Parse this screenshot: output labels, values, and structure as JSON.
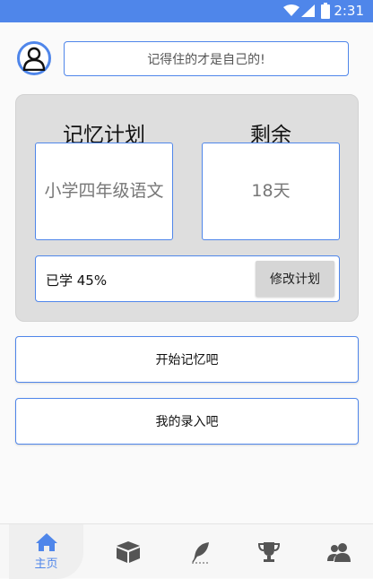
{
  "status_bar": {
    "time": "2:31",
    "icons": [
      "wifi-icon",
      "signal-icon",
      "battery-icon"
    ]
  },
  "header": {
    "motto": "记得住的才是自己的!"
  },
  "plan": {
    "plan_title": "记忆计划",
    "remaining_title": "剩余",
    "plan_name": "小学四年级语文",
    "remaining_days": "18天",
    "progress_text": "已学 45%",
    "progress_percent": 45,
    "edit_label": "修改计划"
  },
  "actions": {
    "start_label": "开始记忆吧",
    "entry_label": "我的录入吧"
  },
  "tabs": [
    {
      "label": "主页",
      "icon": "home-icon",
      "active": true
    },
    {
      "label": "",
      "icon": "box-icon",
      "active": false
    },
    {
      "label": "",
      "icon": "feather-icon",
      "active": false
    },
    {
      "label": "",
      "icon": "trophy-icon",
      "active": false
    },
    {
      "label": "",
      "icon": "users-icon",
      "active": false
    }
  ],
  "colors": {
    "accent": "#4f86ea",
    "card_bg": "#dedede",
    "icon_gray": "#555555"
  }
}
